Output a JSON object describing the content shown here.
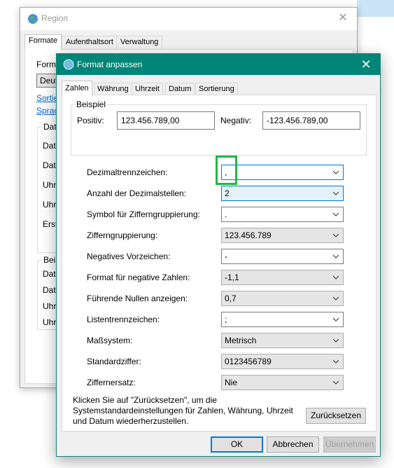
{
  "region": {
    "title": "Region",
    "tabs": [
      "Formate",
      "Aufenthaltsort",
      "Verwaltung"
    ],
    "format_label": "Form",
    "combo_value": "Deut",
    "links": [
      "Sortie",
      "Sprac"
    ],
    "date_group": {
      "title": "Dat",
      "items": [
        "Date",
        "Date",
        "Uhr",
        "Uhr",
        "Erst"
      ]
    },
    "example_group": {
      "title": "Beis",
      "items": [
        "Date",
        "Date",
        "Uhr",
        "Uhr"
      ]
    }
  },
  "dialog": {
    "title": "Format anpassen",
    "tabs": [
      "Zahlen",
      "Währung",
      "Uhrzeit",
      "Datum",
      "Sortierung"
    ],
    "example": {
      "title": "Beispiel",
      "positive_label": "Positiv:",
      "positive_value": "123.456.789,00",
      "negative_label": "Negativ:",
      "negative_value": "-123.456.789,00"
    },
    "rows": [
      {
        "label": "Dezimaltrennzeichen:",
        "value": ","
      },
      {
        "label": "Anzahl der Dezimalstellen:",
        "value": "2"
      },
      {
        "label": "Symbol für Zifferngruppierung:",
        "value": "."
      },
      {
        "label": "Zifferngruppierung:",
        "value": "123.456.789"
      },
      {
        "label": "Negatives Vorzeichen:",
        "value": "-"
      },
      {
        "label": "Format für negative Zahlen:",
        "value": "-1,1"
      },
      {
        "label": "Führende Nullen anzeigen:",
        "value": "0,7"
      },
      {
        "label": "Listentrennzeichen:",
        "value": ";"
      },
      {
        "label": "Maßsystem:",
        "value": "Metrisch"
      },
      {
        "label": "Standardziffer:",
        "value": "0123456789"
      },
      {
        "label": "Ziffernersatz:",
        "value": "Nie"
      }
    ],
    "description": [
      "Klicken Sie auf \"Zurücksetzen\", um die",
      "Systemstandardeinstellungen für Zahlen, Währung, Uhrzeit",
      "und Datum wiederherzustellen."
    ],
    "reset_label": "Zurücksetzen",
    "ok_label": "OK",
    "cancel_label": "Abbrechen",
    "apply_label": "Übernehmen"
  },
  "colors": {
    "dialog_titlebar": "#008577",
    "focus_border": "#0078d7",
    "annotation_box": "#29b34a",
    "link": "#0066cc"
  }
}
